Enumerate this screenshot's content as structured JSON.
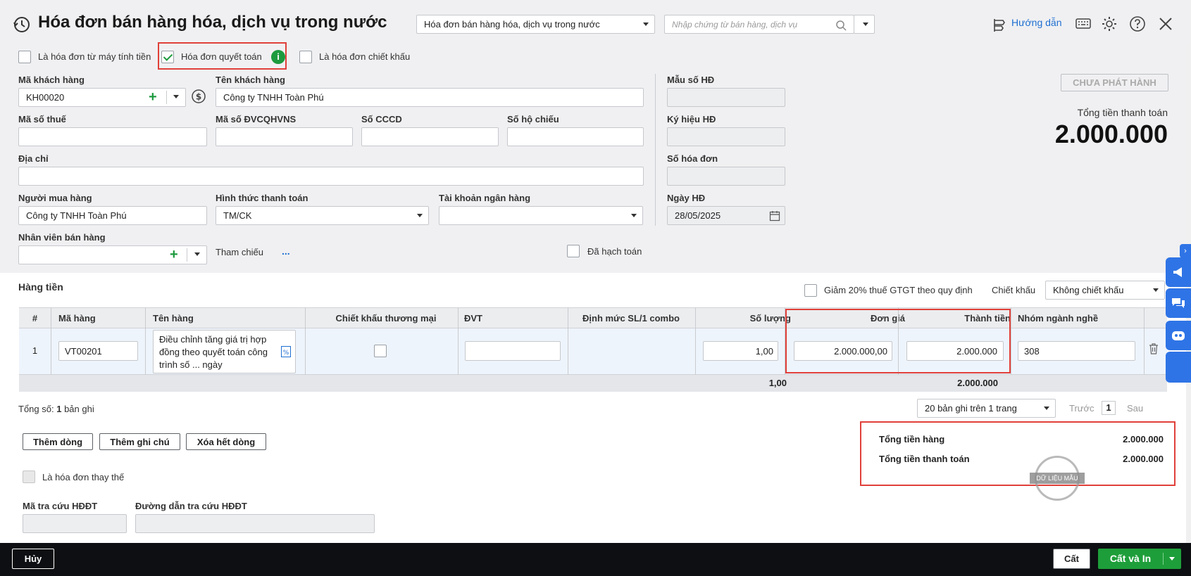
{
  "header": {
    "title": "Hóa đơn bán hàng hóa, dịch vụ trong nước",
    "invoice_type_value": "Hóa đơn bán hàng hóa, dịch vụ trong nước",
    "search_placeholder": "Nhập chứng từ bán hàng, dịch vụ",
    "help_label": "Hướng dẫn"
  },
  "options": {
    "from_cash_register": "Là hóa đơn từ máy tính tiền",
    "settlement_invoice": "Hóa đơn quyết toán",
    "discount_invoice": "Là hóa đơn chiết khấu"
  },
  "form": {
    "customer_code_label": "Mã khách hàng",
    "customer_code_value": "KH00020",
    "customer_name_label": "Tên khách hàng",
    "customer_name_value": "Công ty TNHH Toàn Phú",
    "tax_code_label": "Mã số thuế",
    "budget_code_label": "Mã số ĐVCQHVNS",
    "cccd_label": "Số CCCD",
    "passport_label": "Số hộ chiếu",
    "address_label": "Địa chỉ",
    "buyer_label": "Người mua hàng",
    "buyer_value": "Công ty TNHH Toàn Phú",
    "payment_label": "Hình thức thanh toán",
    "payment_value": "TM/CK",
    "bank_account_label": "Tài khoản ngân hàng",
    "salesperson_label": "Nhân viên bán hàng",
    "reference_label": "Tham chiếu",
    "reference_more": "...",
    "posted_label": "Đã hạch toán",
    "template_label": "Mẫu số HĐ",
    "symbol_label": "Ký hiệu HĐ",
    "invoice_no_label": "Số hóa đơn",
    "invoice_date_label": "Ngày HĐ",
    "invoice_date_value": "28/05/2025"
  },
  "status": {
    "badge": "CHƯA PHÁT HÀNH",
    "total_label": "Tổng tiền thanh toán",
    "total_value": "2.000.000"
  },
  "items": {
    "section_title": "Hàng tiền",
    "vat_reduction_label": "Giảm 20% thuế GTGT theo quy định",
    "discount_label": "Chiết khấu",
    "discount_value": "Không chiết khấu",
    "columns": {
      "index": "#",
      "code": "Mã hàng",
      "name": "Tên hàng",
      "trade_discount": "Chiết khấu thương mại",
      "unit": "ĐVT",
      "combo": "Định mức SL/1 combo",
      "quantity": "Số lượng",
      "unit_price": "Đơn giá",
      "amount": "Thành tiền",
      "industry": "Nhóm ngành nghề"
    },
    "rows": [
      {
        "index": "1",
        "code": "VT00201",
        "name": "Điều chỉnh tăng giá trị hợp đồng theo quyết toán công trình số ... ngày",
        "quantity": "1,00",
        "unit_price": "2.000.000,00",
        "amount": "2.000.000",
        "industry": "308"
      }
    ],
    "sum_quantity": "1,00",
    "sum_amount": "2.000.000"
  },
  "pagination": {
    "total_prefix": "Tổng số:",
    "total_count": "1",
    "total_suffix": "bản ghi",
    "page_size": "20 bản ghi trên 1 trang",
    "prev": "Trước",
    "page": "1",
    "next": "Sau"
  },
  "actions": {
    "add_row": "Thêm dòng",
    "add_note": "Thêm ghi chú",
    "delete_all": "Xóa hết dòng"
  },
  "totals": {
    "goods_label": "Tổng tiền hàng",
    "goods_value": "2.000.000",
    "payment_label": "Tổng tiền thanh toán",
    "payment_value": "2.000.000",
    "stamp": "DỮ LIỆU MẪU"
  },
  "replacement": {
    "label": "Là hóa đơn thay thế",
    "lookup_code_label": "Mã tra cứu HĐĐT",
    "lookup_url_label": "Đường dẫn tra cứu HĐĐT"
  },
  "footer": {
    "cancel": "Hủy",
    "save": "Cất",
    "save_print": "Cất và In"
  },
  "colors": {
    "accent_green": "#1c9a3e",
    "highlight_red": "#e0403a",
    "side_blue": "#2f74e6",
    "link_blue": "#1f6fd1"
  }
}
